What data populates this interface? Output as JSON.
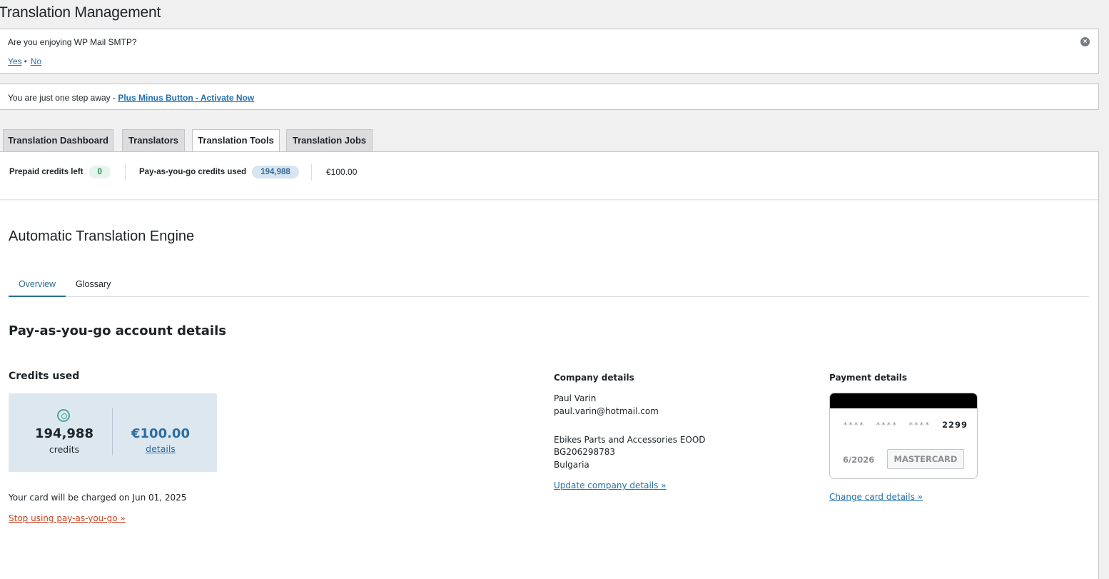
{
  "page_title": "Translation Management",
  "smtp_notice": {
    "question": "Are you enjoying WP Mail SMTP?",
    "yes": "Yes",
    "separator": "•",
    "no": "No"
  },
  "plus_notice": {
    "text": "You are just one step away - ",
    "link": "Plus Minus Button - Activate Now"
  },
  "tabs": [
    {
      "label": "Translation Dashboard",
      "active": false
    },
    {
      "label": "Translators",
      "active": false
    },
    {
      "label": "Translation Tools",
      "active": true
    },
    {
      "label": "Translation Jobs",
      "active": false
    }
  ],
  "credits_bar": {
    "prepaid_label": "Prepaid credits left",
    "prepaid_value": "0",
    "payg_label": "Pay-as-you-go credits used",
    "payg_value": "194,988",
    "amount": "€100.00"
  },
  "engine_title": "Automatic Translation Engine",
  "subtabs": [
    {
      "label": "Overview",
      "active": true
    },
    {
      "label": "Glossary",
      "active": false
    }
  ],
  "section_title": "Pay-as-you-go account details",
  "credits_used": {
    "heading": "Credits used",
    "icon": "coin-icon",
    "credits_value": "194,988",
    "credits_unit": "credits",
    "amount": "€100.00",
    "details_link": "details",
    "charge_note": "Your card will be charged on Jun 01, 2025",
    "stop_link": "Stop using pay-as-you-go »"
  },
  "company": {
    "heading": "Company details",
    "name": "Paul Varin",
    "email": "paul.varin@hotmail.com",
    "company_name": "Ebikes Parts and Accessories EOOD",
    "vat": "BG206298783",
    "country": "Bulgaria",
    "update_link": "Update company details »"
  },
  "payment": {
    "heading": "Payment details",
    "mask1": "****",
    "mask2": "****",
    "mask3": "****",
    "last4": "2299",
    "expiry": "6/2026",
    "brand": "MASTERCARD",
    "change_link": "Change card details »"
  },
  "colors": {
    "accent": "#2271b1",
    "stop_link": "#c9421f",
    "credits_box_bg": "#dde7ef"
  }
}
